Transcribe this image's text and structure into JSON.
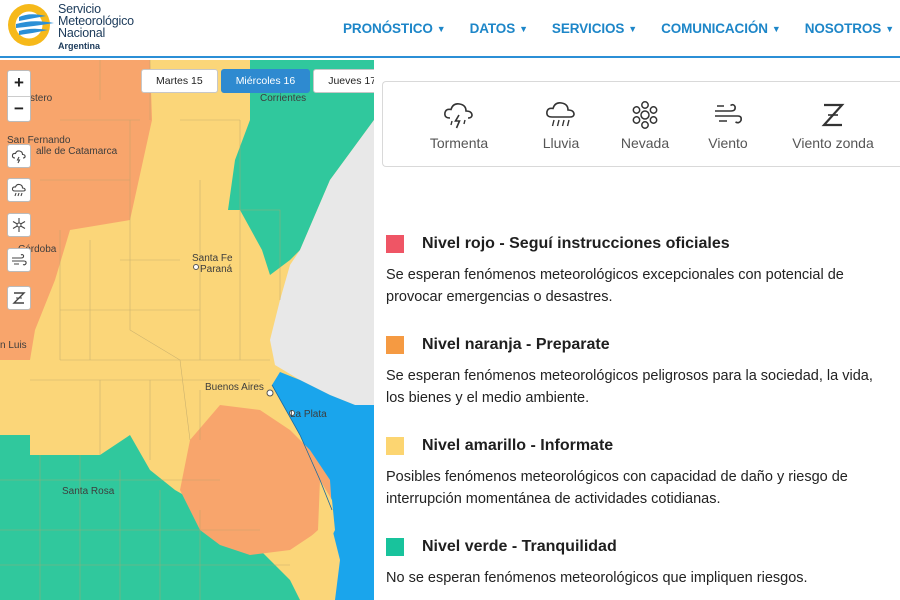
{
  "brand": {
    "line1": "Servicio",
    "line2": "Meteorológico",
    "line3": "Nacional",
    "country": "Argentina"
  },
  "nav": [
    "PRONÓSTICO",
    "DATOS",
    "SERVICIOS",
    "COMUNICACIÓN",
    "NOSOTROS"
  ],
  "colors": {
    "accent": "#1d86c8",
    "rojo": "#ef5565",
    "naranja": "#f59a42",
    "amarillo": "#fcd571",
    "verde": "#18c39c",
    "map_orange": "#f8a56c",
    "map_yellow": "#fbd679",
    "map_green": "#30c89d",
    "water": "#1aa5ec",
    "uruguay": "#e8e8e8"
  },
  "map": {
    "zoom_in": "+",
    "zoom_out": "−",
    "days": [
      {
        "label": "Martes 15",
        "active": false
      },
      {
        "label": "Miércoles 16",
        "active": true
      },
      {
        "label": "Jueves 17",
        "active": false
      }
    ],
    "layer_buttons": [
      "storm-icon",
      "rain-icon",
      "snow-icon",
      "wind-icon",
      "zonda-icon"
    ],
    "labels": {
      "estero": "stero",
      "corrientes": "Corrientes",
      "san_fernando_1": "San Fernando",
      "san_fernando_2": "alle de Catamarca",
      "cordoba": "Córdoba",
      "santa_fe": "Santa Fe",
      "parana": "Paraná",
      "san_luis": "n Luis",
      "buenos_aires": "Buenos Aires",
      "la_plata": "La Plata",
      "santa_rosa": "Santa Rosa"
    }
  },
  "phenomena": [
    {
      "icon": "thunderstorm-icon",
      "label": "Tormenta"
    },
    {
      "icon": "rain-icon",
      "label": "Lluvia"
    },
    {
      "icon": "snowflake-icon",
      "label": "Nevada"
    },
    {
      "icon": "wind-icon",
      "label": "Viento"
    },
    {
      "icon": "zonda-icon",
      "label": "Viento zonda"
    }
  ],
  "levels": [
    {
      "title": "Nivel rojo - Seguí instrucciones oficiales",
      "description": "Se esperan fenómenos meteorológicos excepcionales con potencial de provocar emergencias o desastres."
    },
    {
      "title": "Nivel naranja - Preparate",
      "description": "Se esperan fenómenos meteorológicos peligrosos para la sociedad, la vida, los bienes y el medio ambiente."
    },
    {
      "title": "Nivel amarillo - Informate",
      "description": "Posibles fenómenos meteorológicos con capacidad de daño y riesgo de interrupción momentánea de actividades cotidianas."
    },
    {
      "title": "Nivel verde - Tranquilidad",
      "description": "No se esperan fenómenos meteorológicos que impliquen riesgos."
    }
  ]
}
